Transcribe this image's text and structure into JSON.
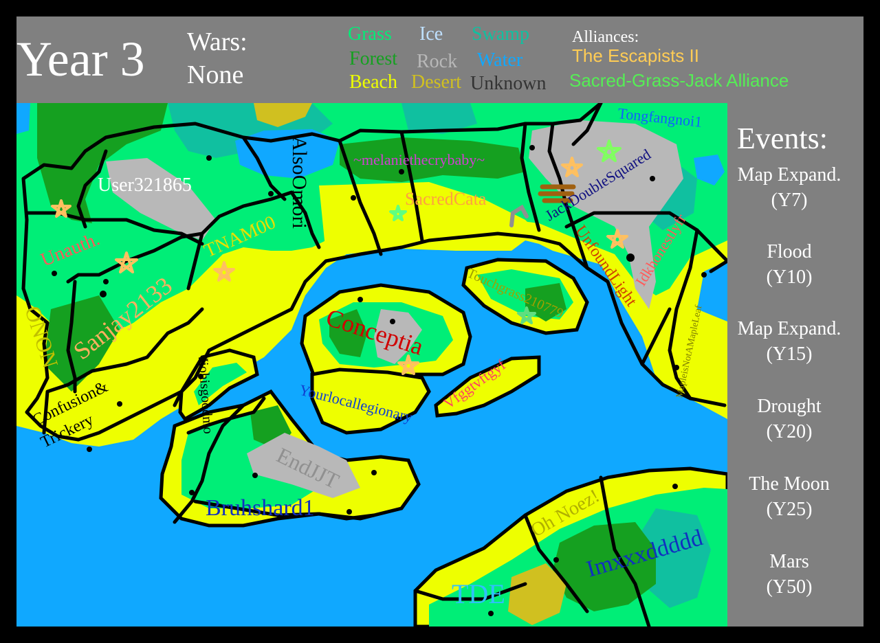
{
  "header": {
    "year": "Year 3",
    "wars_label": "Wars:",
    "wars_value": "None"
  },
  "legend": {
    "items": [
      {
        "label": "Grass",
        "color": "#00ee77"
      },
      {
        "label": "Ice",
        "color": "#bfe0ff"
      },
      {
        "label": "Swamp",
        "color": "#10c0a0"
      },
      {
        "label": "Forest",
        "color": "#15a020"
      },
      {
        "label": "Rock",
        "color": "#b8b8b8"
      },
      {
        "label": "Water",
        "color": "#10a8ff"
      },
      {
        "label": "Beach",
        "color": "#eeff00"
      },
      {
        "label": "Desert",
        "color": "#d0c020"
      },
      {
        "label": "Unknown",
        "color": "#333333"
      }
    ]
  },
  "alliances": {
    "label": "Alliances:",
    "items": [
      {
        "name": "The Escapists II",
        "color": "#ffcc55"
      },
      {
        "name": "Sacred-Grass-Jack Alliance",
        "color": "#55ee55"
      }
    ]
  },
  "events": {
    "title": "Events:",
    "items": [
      {
        "name": "Map Expand.",
        "year": "(Y7)"
      },
      {
        "name": "Flood",
        "year": "(Y10)"
      },
      {
        "name": "Map Expand.",
        "year": "(Y15)"
      },
      {
        "name": "Drought",
        "year": "(Y20)"
      },
      {
        "name": "The Moon",
        "year": "(Y25)"
      },
      {
        "name": "Mars",
        "year": "(Y50)"
      }
    ]
  },
  "map": {
    "colors": {
      "water": "#10a8ff",
      "grass": "#00ee77",
      "beach": "#eeff00",
      "forest": "#15a020",
      "swamp": "#10c0a0",
      "rock": "#b8b8b8",
      "desert": "#d0c020",
      "border": "#000000"
    },
    "players": [
      {
        "name": "User321865",
        "color": "#ffffff"
      },
      {
        "name": "AlsoOmori",
        "color": "#000000"
      },
      {
        "name": "~melaniethecrybaby~",
        "color": "#d040d0"
      },
      {
        "name": "SacredCata",
        "color": "#ffa040"
      },
      {
        "name": "Tongfangnoi1",
        "color": "#1060ff"
      },
      {
        "name": "JackDoubleSquared",
        "color": "#101080"
      },
      {
        "name": "Unauth.",
        "color": "#ff5a5a"
      },
      {
        "name": "TNAM00",
        "color": "#e8e000"
      },
      {
        "name": "UnfoundLight",
        "color": "#d04000"
      },
      {
        "name": "Idkhonestlyfr",
        "color": "#ff5a5a"
      },
      {
        "name": "Sanjay2133",
        "color": "#ffb060"
      },
      {
        "name": "ONON",
        "color": "#c0c000"
      },
      {
        "name": "Touchgrass210779",
        "color": "#a0a000"
      },
      {
        "name": "Conceptia",
        "color": "#d00000"
      },
      {
        "name": "MapleisNotAMapleLeaf",
        "color": "#808000"
      },
      {
        "name": "Confusion&",
        "color": "#000000"
      },
      {
        "name": "Trickery",
        "color": "#000000"
      },
      {
        "name": "Jiohisgoodmo",
        "color": "#000000"
      },
      {
        "name": "Yourlocallegionary",
        "color": "#1040d0"
      },
      {
        "name": "Vfggtvftgyf",
        "color": "#ff4060"
      },
      {
        "name": "EndJJT",
        "color": "#909090"
      },
      {
        "name": "Bruhshard1",
        "color": "#1030c0"
      },
      {
        "name": "Oh Noez!",
        "color": "#b0b000"
      },
      {
        "name": "Imxxxddddd",
        "color": "#1030c0"
      },
      {
        "name": "TDE",
        "color": "#30c0ff"
      }
    ]
  }
}
